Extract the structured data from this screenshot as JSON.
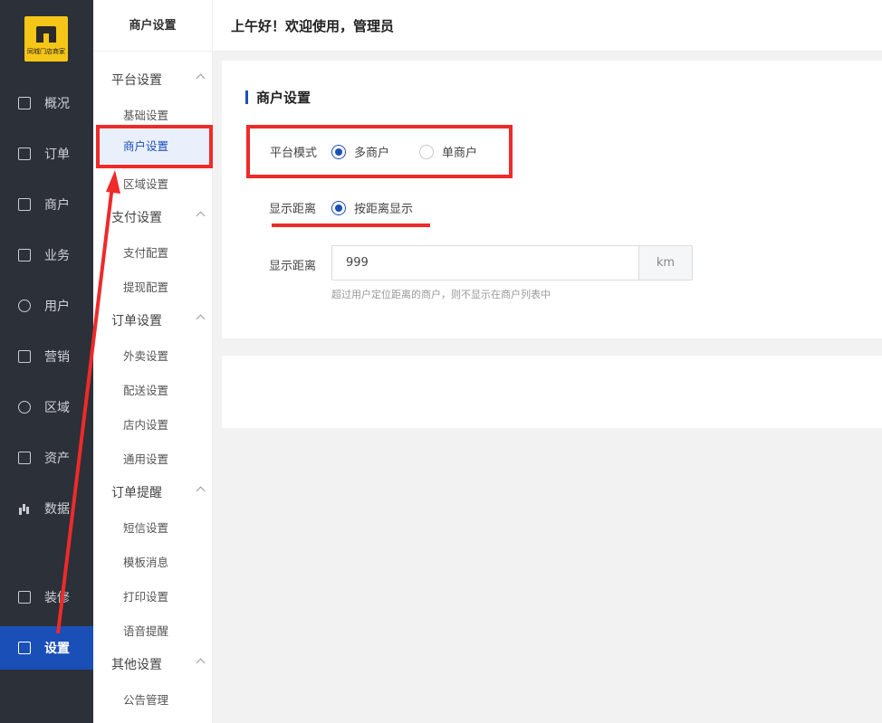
{
  "nav": {
    "logo_text": "同城门店商家",
    "items": [
      {
        "label": "概况",
        "icon": "chart-board-icon"
      },
      {
        "label": "订单",
        "icon": "document-list-icon"
      },
      {
        "label": "商户",
        "icon": "store-icon"
      },
      {
        "label": "业务",
        "icon": "briefcase-icon"
      },
      {
        "label": "用户",
        "icon": "user-icon"
      },
      {
        "label": "营销",
        "icon": "shopping-bag-icon"
      },
      {
        "label": "区域",
        "icon": "database-icon"
      },
      {
        "label": "资产",
        "icon": "wallet-icon"
      },
      {
        "label": "数据",
        "icon": "bar-chart-icon"
      },
      {
        "label": "装修",
        "icon": "paint-icon"
      },
      {
        "label": "设置",
        "icon": "settings-icon"
      }
    ],
    "active": "设置"
  },
  "subnav": {
    "title": "商户设置",
    "groups": [
      {
        "label": "平台设置",
        "items": [
          "基础设置",
          "商户设置",
          "区域设置"
        ]
      },
      {
        "label": "支付设置",
        "items": [
          "支付配置",
          "提现配置"
        ]
      },
      {
        "label": "订单设置",
        "items": [
          "外卖设置",
          "配送设置",
          "店内设置",
          "通用设置"
        ]
      },
      {
        "label": "订单提醒",
        "items": [
          "短信设置",
          "模板消息",
          "打印设置",
          "语音提醒"
        ]
      },
      {
        "label": "其他设置",
        "items": [
          "公告管理"
        ]
      }
    ],
    "active_item": "商户设置"
  },
  "header": {
    "greeting": "上午好！欢迎使用，管理员"
  },
  "form": {
    "section_title": "商户设置",
    "platform_mode": {
      "label": "平台模式",
      "options": [
        "多商户",
        "单商户"
      ],
      "selected": "多商户"
    },
    "distance_display": {
      "label": "显示距离",
      "option": "按距离显示",
      "selected": true
    },
    "distance": {
      "label": "显示距离",
      "value": "999",
      "unit": "km",
      "hint": "超过用户定位距离的商户，则不显示在商户列表中"
    }
  },
  "colors": {
    "accent": "#1b4fb8",
    "nav_bg": "#2c3038",
    "annotation": "#ef2a2a",
    "logo": "#f5c518"
  }
}
